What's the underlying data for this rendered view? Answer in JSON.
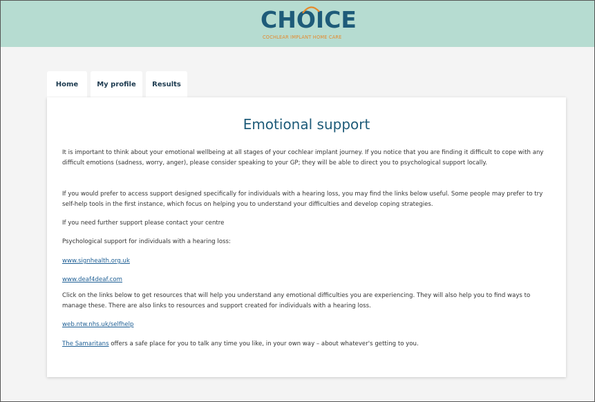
{
  "brand": {
    "logo_text": "CHOICE",
    "logo_subtitle": "COCHLEAR IMPLANT HOME CARE",
    "colors": {
      "header_bg": "#b6dcd1",
      "title": "#1e5b79",
      "accent": "#e58a2c",
      "link": "#1d5e94"
    }
  },
  "tabs": [
    {
      "label": "Home"
    },
    {
      "label": "My profile"
    },
    {
      "label": "Results"
    }
  ],
  "page": {
    "title": "Emotional support",
    "para1": "It is important to think about your emotional wellbeing at all stages of your cochlear implant journey. If you notice that you are finding it difficult to cope with any difficult emotions (sadness, worry, anger), please consider speaking to your GP; they will be able to direct you to psychological support locally.",
    "para2": "If you would prefer to access support designed specifically for individuals with a hearing loss, you may find the links below useful. Some people may prefer to try self-help tools in the first instance, which focus on helping you to understand your difficulties and develop coping strategies.",
    "para3": "If you need further support please contact your centre",
    "para4": "Psychological support for individuals with a hearing loss:",
    "link1": "www.signhealth.org.uk",
    "link2": "www.deaf4deaf.com",
    "para5": "Click on the links below to get resources that will help you understand any emotional difficulties you are experiencing. They will also help you to find ways to manage these. There are also links to resources and support created for individuals with a hearing loss.",
    "link3": "web.ntw.nhs.uk/selfhelp",
    "samaritans_link": "The Samaritans",
    "samaritans_text": " offers a safe place for you to talk any time you like, in your own way – about whatever's getting to you."
  }
}
